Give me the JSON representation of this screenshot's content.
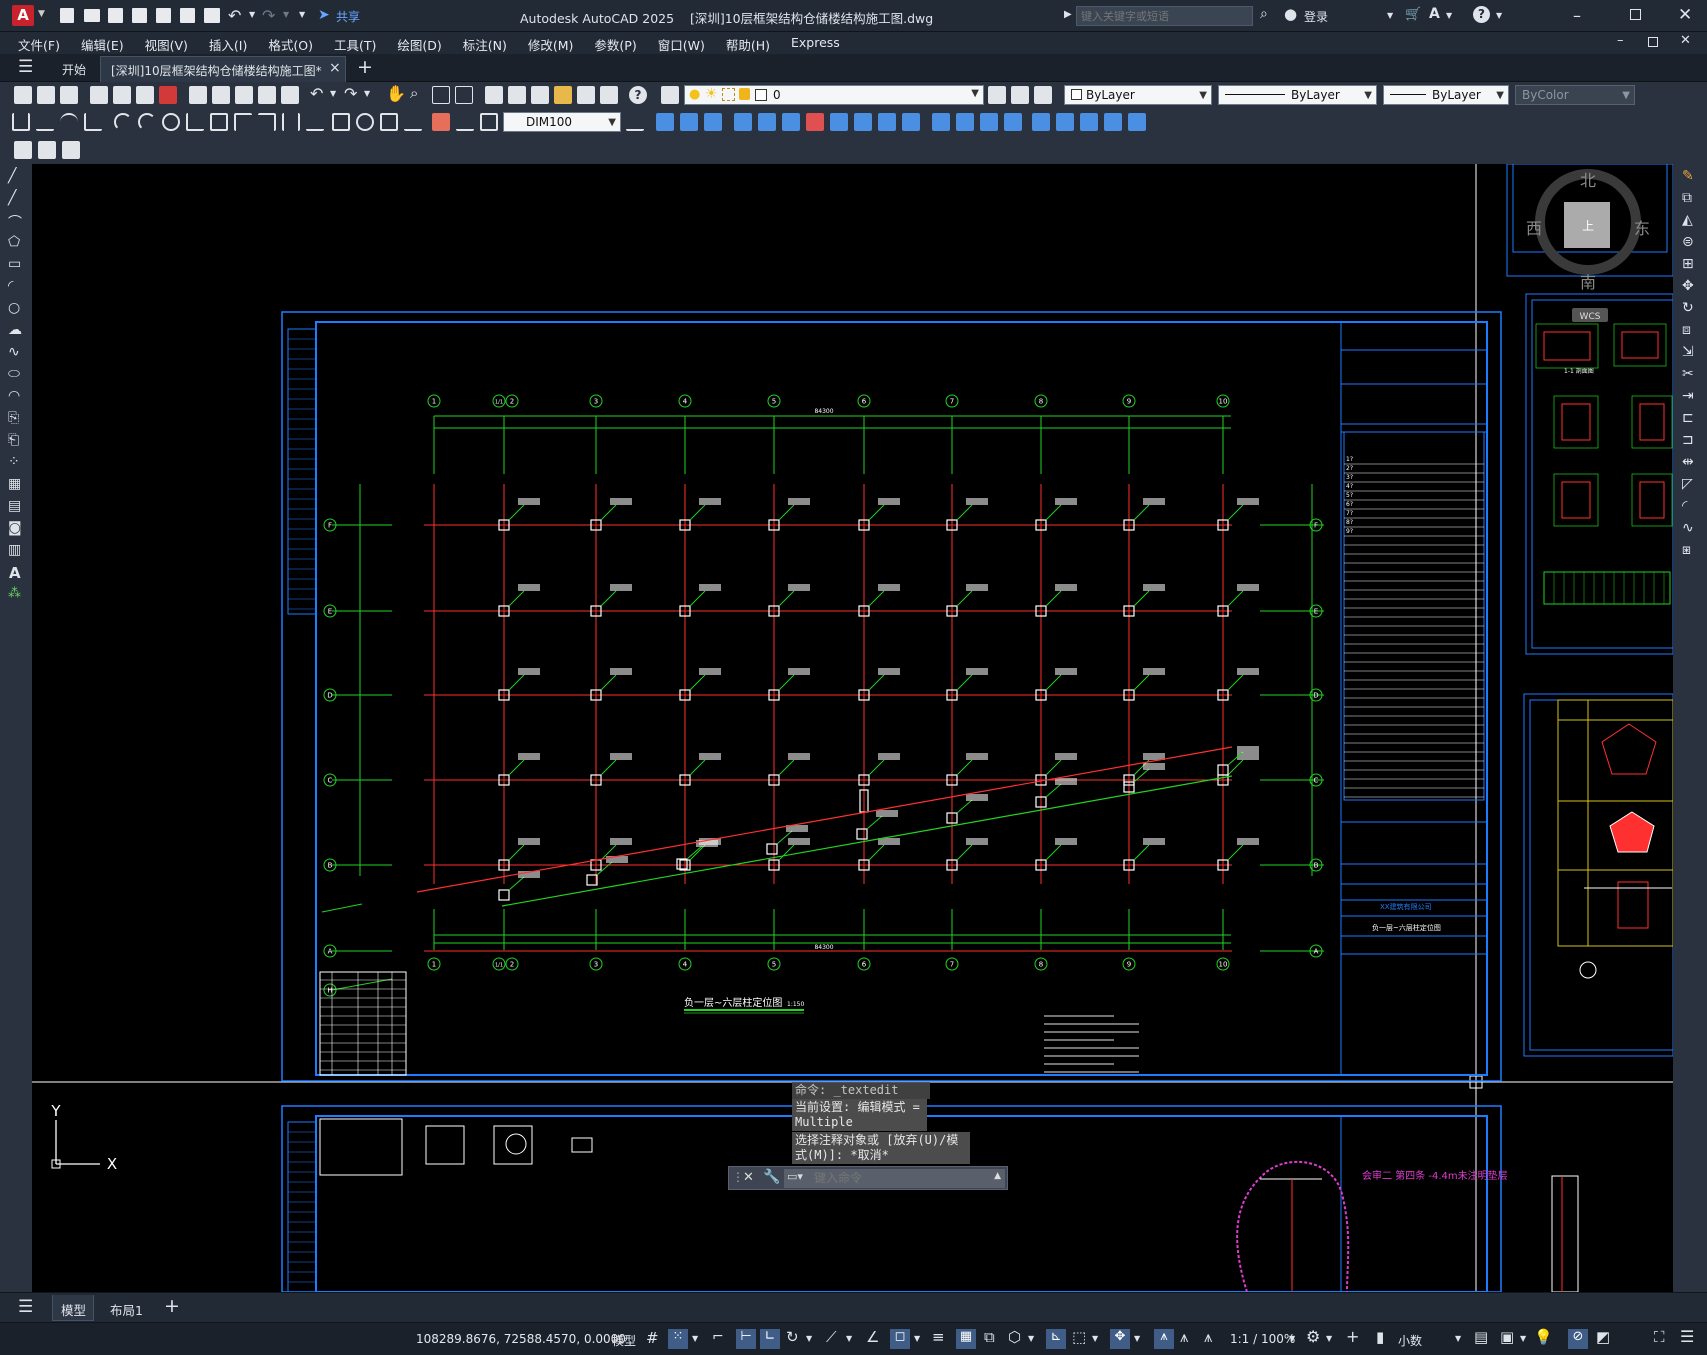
{
  "window": {
    "title": "Autodesk AutoCAD 2025    [深圳]10层框架结构仓储楼结构施工图.dwg",
    "app_letter": "A",
    "share_label": "共享",
    "search_placeholder": "键入关键字或短语",
    "login_label": "登录"
  },
  "menu": [
    "文件(F)",
    "编辑(E)",
    "视图(V)",
    "插入(I)",
    "格式(O)",
    "工具(T)",
    "绘图(D)",
    "标注(N)",
    "修改(M)",
    "参数(P)",
    "窗口(W)",
    "帮助(H)",
    "Express"
  ],
  "tabs": {
    "start": "开始",
    "doc": "[深圳]10层框架结构仓储楼结构施工图*",
    "close": "×",
    "add": "+"
  },
  "toolbar": {
    "layer_value": "0",
    "color_value": "ByLayer",
    "linetype_value": "ByLayer",
    "lineweight_value": "ByLayer",
    "plotstyle_value": "ByColor",
    "dimstyle_value": "DIM100"
  },
  "viewcube": {
    "north": "北",
    "south": "南",
    "east": "东",
    "west": "西",
    "top": "上",
    "wcs": "WCS"
  },
  "drawing": {
    "plan_title": "负一层~六层柱定位图",
    "plan_scale": "1:150",
    "grid_cols": [
      "1",
      "1/1",
      "2",
      "3",
      "4",
      "5",
      "6",
      "7",
      "8",
      "9",
      "10"
    ],
    "grid_rows": [
      "F",
      "E",
      "D",
      "C",
      "B",
      "A",
      "H"
    ],
    "total_dim": "84300",
    "right_list": [
      "1?",
      "2?",
      "3?",
      "4?",
      "5?",
      "6?",
      "7?",
      "8?",
      "9?"
    ],
    "company": "XX建筑有限公司",
    "sheet_name": "负一层~六层柱定位图",
    "review_note": "会审二 第四条 -4.4m未注明垫层",
    "detail_caption": "1-1 剖面图"
  },
  "ucs": {
    "x": "X",
    "y": "Y"
  },
  "command": {
    "lines": [
      "命令: _textedit",
      "当前设置: 编辑模式 = Multiple",
      "选择注释对象或 [放弃(U)/模式(M)]: *取消*"
    ],
    "placeholder": "键入命令"
  },
  "bottom_tabs": {
    "model": "模型",
    "layout1": "布局1",
    "add": "+"
  },
  "status": {
    "coords": "108289.8676, 72588.4570, 0.0000",
    "mode": "模型",
    "scale": "1:1 / 100%",
    "units": "小数"
  }
}
